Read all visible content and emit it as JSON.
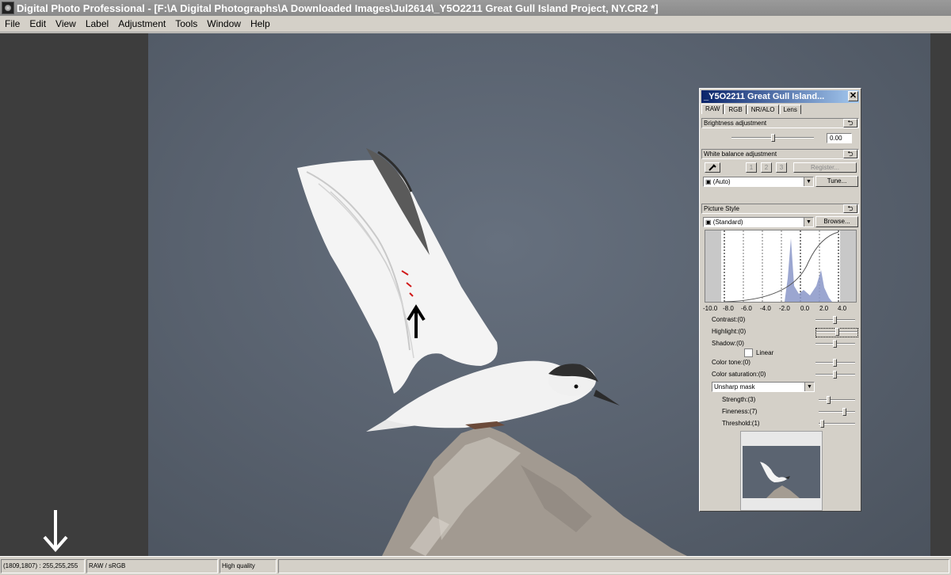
{
  "window": {
    "title": "Digital Photo Professional - [F:\\A Digital Photographs\\A Downloaded Images\\Jul2614\\_Y5O2211  Great Gull Island Project, NY.CR2 *]"
  },
  "menu": [
    "File",
    "Edit",
    "View",
    "Label",
    "Adjustment",
    "Tools",
    "Window",
    "Help"
  ],
  "palette": {
    "title": "_Y5O2211  Great Gull Island...",
    "close": "✕",
    "tabs": [
      "RAW",
      "RGB",
      "NR/ALO",
      "Lens"
    ],
    "active_tab": "RAW",
    "brightness": {
      "header": "Brightness adjustment",
      "value": "0.00",
      "level": 0.5
    },
    "white_balance": {
      "header": "White balance adjustment",
      "slots": [
        "1",
        "2",
        "3"
      ],
      "register_label": "Register...",
      "selected": "(Auto)",
      "tune_label": "Tune..."
    },
    "picture_style": {
      "header": "Picture Style",
      "selected": "(Standard)",
      "browse_label": "Browse...",
      "histogram_ticks": [
        "-10.0",
        "-8.0",
        "-6.0",
        "-4.0",
        "-2.0",
        "0.0",
        "2.0",
        "4.0"
      ]
    },
    "adjustments": {
      "contrast": "Contrast:(0)",
      "highlight": "Highlight:(0)",
      "shadow": "Shadow:(0)",
      "linear": "Linear",
      "color_tone": "Color tone:(0)",
      "color_saturation": "Color saturation:(0)",
      "sharpness_mode": "Unsharp mask",
      "strength": "Strength:(3)",
      "fineness": "Fineness:(7)",
      "threshold": "Threshold:(1)"
    },
    "reset_glyph": "⮌"
  },
  "status": {
    "pixel_info": "(1809,1807) : 255,255,255",
    "color_space": "RAW / sRGB",
    "quality": "High quality"
  },
  "colors": {
    "titlebar": "#8f8f8f",
    "palette_title_start": "#0a246a",
    "palette_title_end": "#a6caf0",
    "background": "#3d3d3d"
  }
}
